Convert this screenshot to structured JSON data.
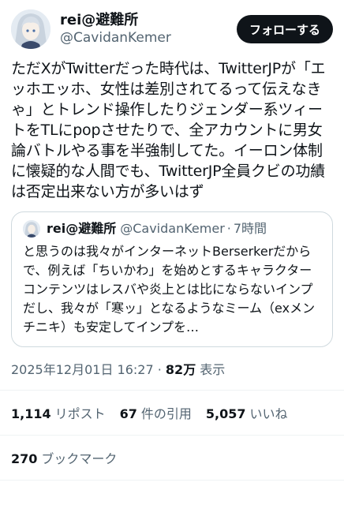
{
  "author": {
    "display_name": "rei@避難所",
    "handle": "@CavidanKemer"
  },
  "follow_button": "フォローする",
  "tweet_text": "ただXがTwitterだった時代は、TwitterJPが「エッホエッホ、女性は差別されてるって伝えなきゃ」とトレンド操作したりジェンダー系ツィートをTLにpopさせたりで、全アカウントに男女論バトルやる事を半強制してた。イーロン体制に懐疑的な人間でも、TwitterJP全員クビの功績は否定出来ない方が多いはず",
  "quote": {
    "display_name": "rei@避難所",
    "handle": "@CavidanKemer",
    "separator": "·",
    "time": "7時間",
    "text": "と思うのは我々がインターネットBerserkerだからで、例えば「ちいかわ」を始めとするキャラクターコンテンツはレスバや炎上とは比にならないインプだし、我々が「寒ッ」となるようなミーム（exメンチニキ）も安定してインプを…"
  },
  "meta": {
    "timestamp": "2025年12月01日 16:27",
    "separator": "·",
    "views_count": "82万",
    "views_label": "表示"
  },
  "stats": {
    "reposts_count": "1,114",
    "reposts_label": "リポスト",
    "quotes_count": "67",
    "quotes_label": "件の引用",
    "likes_count": "5,057",
    "likes_label": "いいね",
    "bookmarks_count": "270",
    "bookmarks_label": "ブックマーク"
  }
}
